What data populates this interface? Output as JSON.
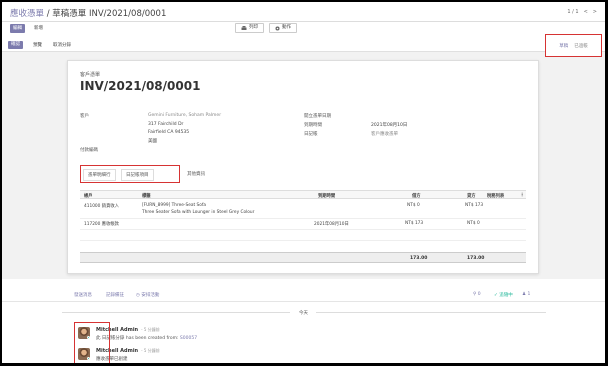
{
  "breadcrumb": {
    "root": "應收憑單",
    "separator": "/",
    "current": "草稿憑單 INV/2021/08/0001"
  },
  "pager": {
    "text": "1 / 1",
    "prev": "<",
    "next": ">"
  },
  "toolbar": {
    "edit": "編輯",
    "create": "新增",
    "print": "列印",
    "action": "動作"
  },
  "actions": {
    "confirm": "確認",
    "preview": "預覽",
    "analytic": "取消分錄"
  },
  "statusbar": {
    "draft": "草稿",
    "posted": "已過帳"
  },
  "invoice": {
    "type": "客戶憑單",
    "number": "INV/2021/08/0001",
    "customer_label": "客戶",
    "customer_name": "Gemini Furniture, Soham Palmer",
    "address_line1": "317 Fairchild Dr",
    "address_line2": "Fairfield CA 94535",
    "country": "美國",
    "payment_ref_label": "付款編碼",
    "invoice_date_label": "開立憑單日期",
    "due_date_label": "到期時間",
    "due_date_value": "2021年08月10日",
    "journal_label": "日記帳",
    "journal_value": "客戶應收憑單"
  },
  "tabs": [
    "憑單明細行",
    "日記帳項目",
    "其他資訊"
  ],
  "table": {
    "headers": [
      "帳戶",
      "標籤",
      "到期時間",
      "借方",
      "貸方",
      "稅務列表"
    ],
    "rows": [
      {
        "account": "411000 銷貨收入",
        "label_line1": "[FURN_8999] Three-Seat Sofa",
        "label_line2": "Three Seater Sofa with Lounger in Steel Grey Colour",
        "due": "",
        "debit": "NT$ 0",
        "credit": "NT$ 173"
      },
      {
        "account": "117200 應收帳款",
        "label_line1": "",
        "label_line2": "",
        "due": "2021年08月10日",
        "debit": "NT$ 173",
        "credit": "NT$ 0"
      }
    ],
    "totals": {
      "debit": "173.00",
      "credit": "173.00"
    }
  },
  "chatter": {
    "send_message": "發送消息",
    "log_note": "記錄備註",
    "schedule": "安排活動",
    "attachments": "0",
    "following": "追隨中",
    "followers": "1",
    "today": "今天",
    "messages": [
      {
        "author": "Mitchell Admin",
        "ago": "- 5 分鐘前",
        "body_prefix": "此 日記帳分錄 has been created from:",
        "body_link": "S00057"
      },
      {
        "author": "Mitchell Admin",
        "ago": "- 5 分鐘前",
        "body_prefix": "應收憑單已創建",
        "body_link": ""
      }
    ]
  },
  "colors": {
    "primary": "#7c7bad",
    "highlight": "#d63333"
  }
}
